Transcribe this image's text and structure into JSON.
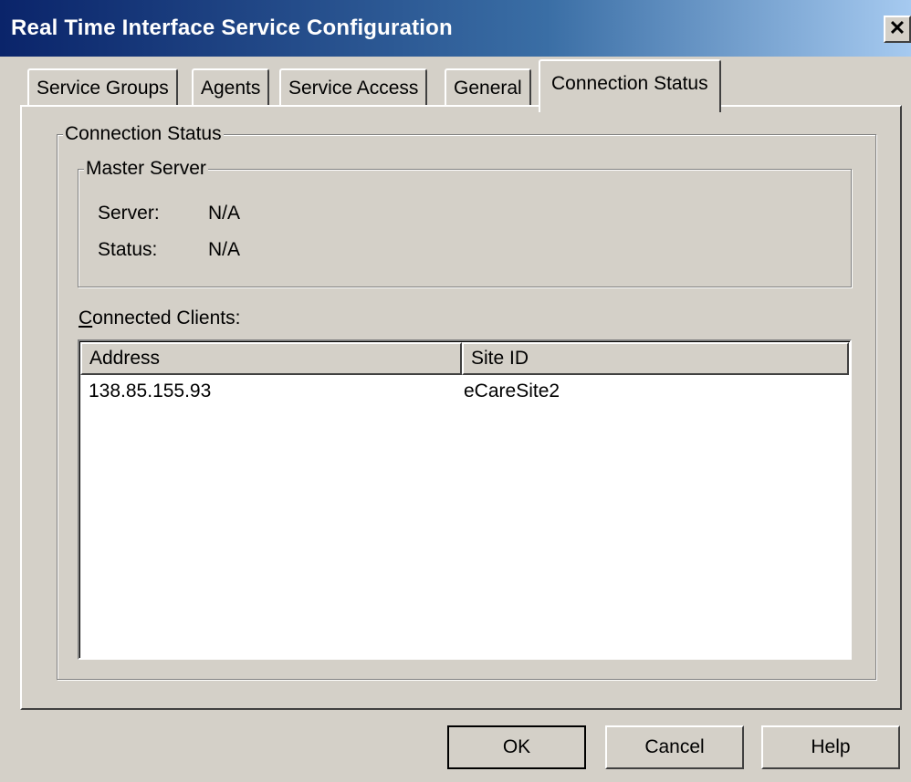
{
  "window": {
    "title": "Real Time Interface Service Configuration",
    "close_glyph": "✕"
  },
  "tabs": [
    {
      "label": "Service Groups",
      "active": false
    },
    {
      "label": "Agents",
      "active": false
    },
    {
      "label": "Service Access",
      "active": false
    },
    {
      "label": "General",
      "active": false
    },
    {
      "label": "Connection Status",
      "active": true
    }
  ],
  "connection_status": {
    "group_label": "Connection Status",
    "master_server": {
      "group_label": "Master Server",
      "server_label": "Server:",
      "server_value": "N/A",
      "status_label": "Status:",
      "status_value": "N/A"
    },
    "connected_clients": {
      "label": "Connected Clients:",
      "columns": [
        "Address",
        "Site ID"
      ],
      "rows": [
        [
          "138.85.155.93",
          "eCareSite2"
        ]
      ]
    }
  },
  "buttons": {
    "ok": "OK",
    "cancel": "Cancel",
    "help": "Help"
  }
}
